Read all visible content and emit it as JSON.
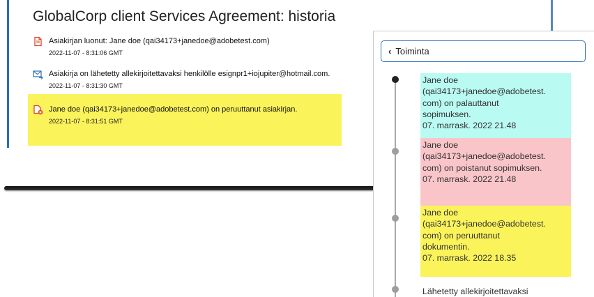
{
  "history": {
    "title": "GlobalCorp client Services Agreement: historia",
    "items": [
      {
        "text": "Asiakirjan luonut: Jane doe (qai34173+janedoe@adobetest.com)",
        "timestamp": "2022-11-07 - 8:31:06 GMT",
        "icon": "document-created-icon"
      },
      {
        "text": "Asiakirja on lähetetty allekirjoitettavaksi henkilölle esignpr1+iojupiter@hotmail.com.",
        "timestamp": "2022-11-07 - 8:31:30 GMT",
        "icon": "email-sent-icon"
      },
      {
        "text": "Jane doe (qai34173+janedoe@adobetest.com) on peruuttanut asiakirjan.",
        "timestamp": "2022-11-07 - 8:31:51 GMT",
        "icon": "document-cancelled-icon"
      }
    ]
  },
  "activity": {
    "header": "Toiminta",
    "entries": [
      {
        "lines": [
          "Jane doe",
          "(qai34173+janedoe@adobetest.",
          "com) on palauttanut",
          "sopimuksen."
        ],
        "date": "07. marrask. 2022 21.48",
        "color": "#b9faf2"
      },
      {
        "lines": [
          "Jane doe",
          "(qai34173+janedoe@adobetest.",
          "com) on poistanut sopimuksen."
        ],
        "date": "07. marrask. 2022 21.48",
        "color": "#f9c5c9"
      },
      {
        "lines": [
          "Jane doe",
          "(qai34173+janedoe@adobetest.",
          "com) on peruuttanut",
          "dokumentin."
        ],
        "date": "07. marrask. 2022 18.35",
        "color": "#fbf35a"
      },
      {
        "lines": [
          "Lähetetty allekirjoitettavaksi"
        ],
        "date": ""
      }
    ]
  },
  "colors": {
    "accent": "#2a6fb5",
    "highlight_yellow": "#fbf35a"
  }
}
